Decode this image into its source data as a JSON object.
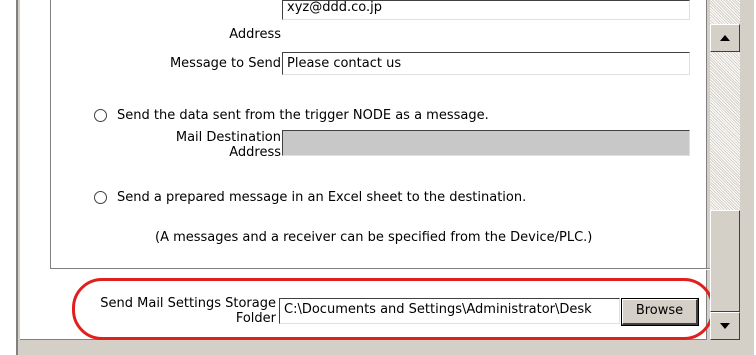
{
  "form": {
    "address_label": "Address",
    "address_value": "xyz@ddd.co.jp",
    "message_label": "Message to Send",
    "message_value": "Please contact us",
    "option_trigger_label": "Send the data sent from the trigger NODE  as a message.",
    "dest_label_line1": "Mail Destination",
    "dest_label_line2": "Address",
    "dest_value": "",
    "option_excel_label": "Send a prepared message in an Excel sheet to the destination.",
    "excel_note": "(A messages and a receiver can be specified from the Device/PLC.)",
    "storage_label_line1": "Send Mail Settings Storage",
    "storage_label_line2": "Folder",
    "storage_value": "C:\\Documents and Settings\\Administrator\\Desk",
    "browse_label": "Browse"
  },
  "scrollbar": {
    "up_icon": "triangle-up-icon",
    "down_icon": "triangle-down-icon"
  },
  "colors": {
    "highlight": "#e0201e",
    "dialog_bg": "#d4d0c8",
    "disabled_field": "#c8c8c8"
  }
}
